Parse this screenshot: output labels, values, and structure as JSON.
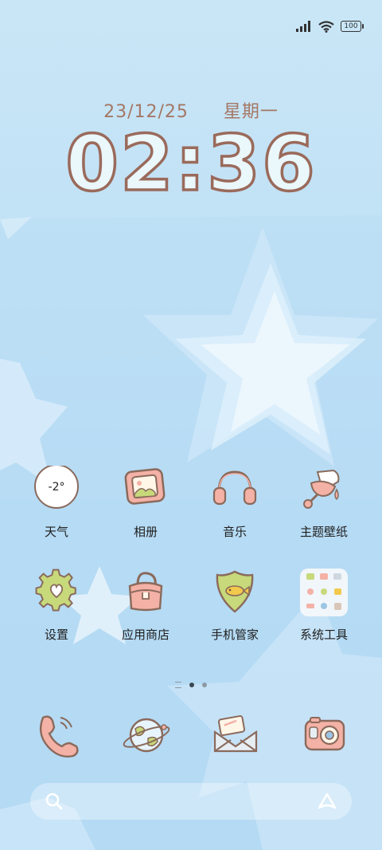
{
  "status_bar": {
    "signal_icon": "signal-bars-icon",
    "wifi_icon": "wifi-icon",
    "battery_level": "100"
  },
  "clock": {
    "date": "23/12/25",
    "weekday": "星期一",
    "time": "02:36"
  },
  "apps": [
    {
      "label": "天气",
      "icon": "weather-icon",
      "value": "-2°"
    },
    {
      "label": "相册",
      "icon": "gallery-icon"
    },
    {
      "label": "音乐",
      "icon": "headphones-icon"
    },
    {
      "label": "主题壁纸",
      "icon": "paint-bucket-icon"
    },
    {
      "label": "设置",
      "icon": "gear-icon"
    },
    {
      "label": "应用商店",
      "icon": "shopping-bag-icon"
    },
    {
      "label": "手机管家",
      "icon": "shield-icon"
    },
    {
      "label": "系统工具",
      "icon": "folder-icon"
    }
  ],
  "page_indicator": {
    "pages": 2,
    "active": 1
  },
  "dock": [
    {
      "icon": "phone-icon"
    },
    {
      "icon": "browser-globe-icon"
    },
    {
      "icon": "messages-envelope-icon"
    },
    {
      "icon": "camera-icon"
    }
  ],
  "search_bar": {
    "search_icon": "search-icon",
    "assistant_icon": "assistant-icon"
  },
  "colors": {
    "accent_text": "#a57765",
    "icon_outline": "#8a6a5c",
    "pink": "#f4b1a6",
    "green": "#c7d97a"
  }
}
